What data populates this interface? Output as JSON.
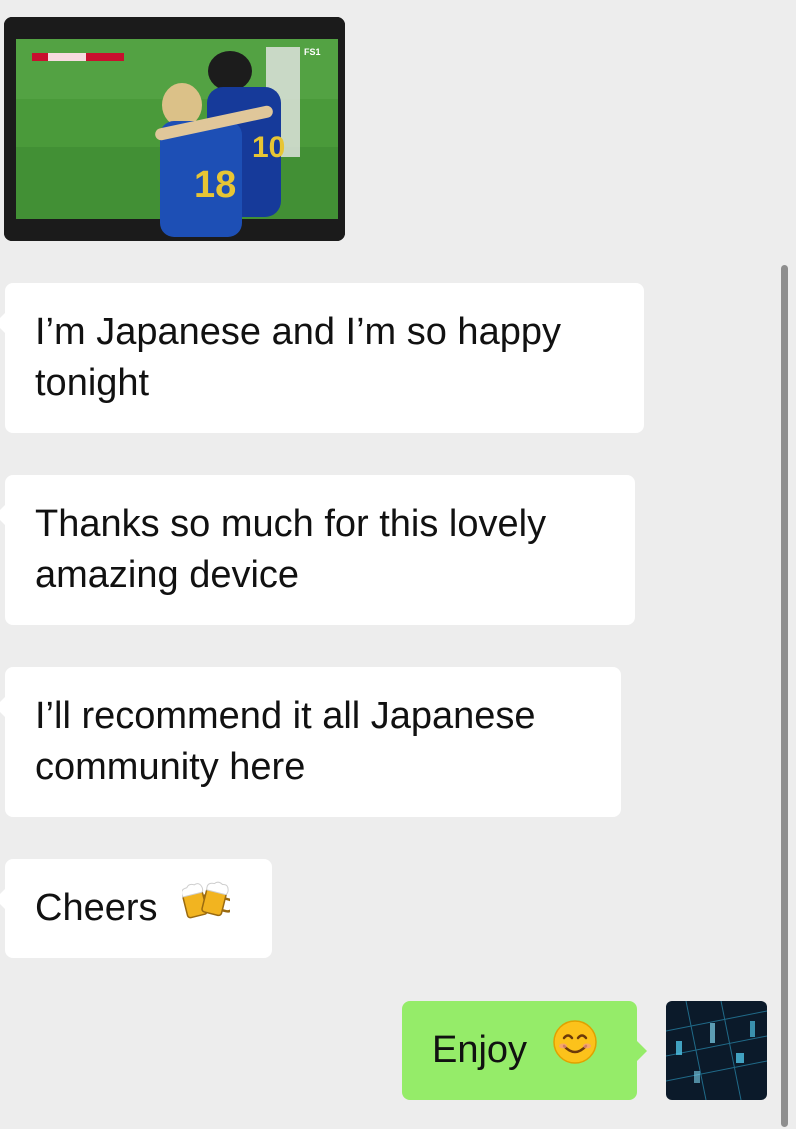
{
  "messages": [
    {
      "side": "received",
      "type": "image",
      "image_description": "TV screenshot of soccer players in blue jerseys celebrating",
      "overlay_text": "FS1",
      "jersey_number": "18"
    },
    {
      "side": "received",
      "type": "text",
      "text": "I’m Japanese and I’m so happy tonight"
    },
    {
      "side": "received",
      "type": "text",
      "text": "Thanks so much for this lovely amazing device"
    },
    {
      "side": "received",
      "type": "text",
      "text": "I’ll recommend it all Japanese community here"
    },
    {
      "side": "received",
      "type": "text",
      "text": "Cheers",
      "emoji": "beer-mugs-icon"
    },
    {
      "side": "sent",
      "type": "text",
      "text": "Enjoy",
      "emoji": "smiling-face-icon"
    }
  ],
  "colors": {
    "background": "#ededed",
    "received_bubble": "#ffffff",
    "sent_bubble": "#95ec69",
    "text": "#111111",
    "scrollbar": "#8e8e8e"
  }
}
